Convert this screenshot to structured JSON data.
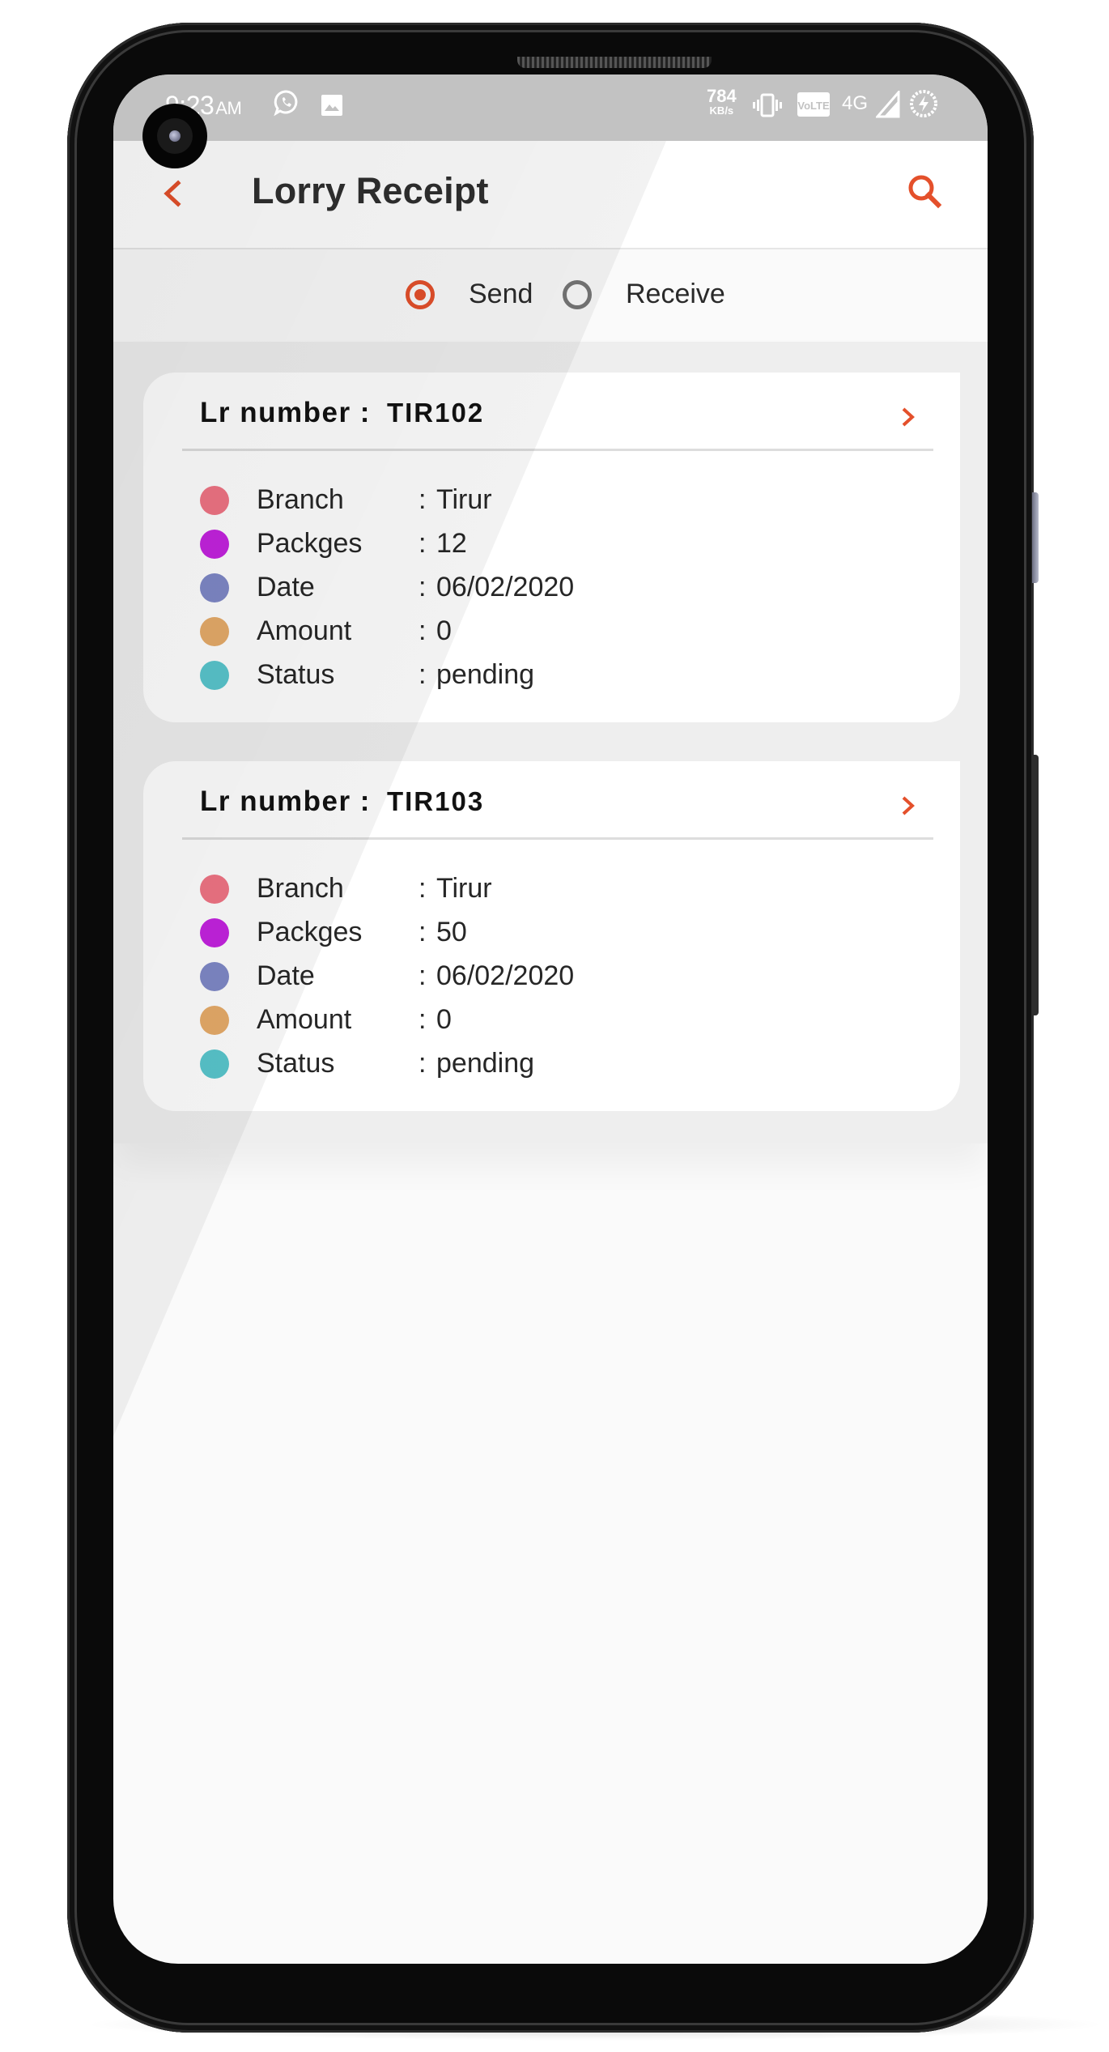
{
  "status_bar": {
    "time": "9:23",
    "ampm": "AM",
    "left_icons": [
      "whatsapp-icon",
      "image-icon"
    ],
    "net_speed_value": "784",
    "net_speed_unit": "KB/s",
    "right_icons": [
      "vibrate-icon",
      "volte-icon",
      "network-4g",
      "signal-icon",
      "battery-charging-icon"
    ],
    "volte_label": "VoLTE",
    "network_label": "4G"
  },
  "app_bar": {
    "title": "Lorry Receipt",
    "back_icon": "chevron-left-icon",
    "search_icon": "search-icon"
  },
  "mode_selector": {
    "options": [
      {
        "label": "Send",
        "selected": true
      },
      {
        "label": "Receive",
        "selected": false
      }
    ]
  },
  "colors": {
    "accent": "#E4502B",
    "branch_dot": "#F07484",
    "packages_dot": "#C423DF",
    "date_dot": "#7F88C7",
    "amount_dot": "#E6AB69",
    "status_dot": "#59C6CD"
  },
  "receipts": [
    {
      "lr_label": "Lr number :",
      "lr_number": "TIR102",
      "fields": [
        {
          "label": "Branch",
          "value": "Tirur"
        },
        {
          "label": "Packges",
          "value": "12"
        },
        {
          "label": "Date",
          "value": "06/02/2020"
        },
        {
          "label": "Amount",
          "value": "0"
        },
        {
          "label": "Status",
          "value": "pending"
        }
      ]
    },
    {
      "lr_label": "Lr number :",
      "lr_number": "TIR103",
      "fields": [
        {
          "label": "Branch",
          "value": "Tirur"
        },
        {
          "label": "Packges",
          "value": "50"
        },
        {
          "label": "Date",
          "value": "06/02/2020"
        },
        {
          "label": "Amount",
          "value": "0"
        },
        {
          "label": "Status",
          "value": "pending"
        }
      ]
    }
  ],
  "separator": ":"
}
